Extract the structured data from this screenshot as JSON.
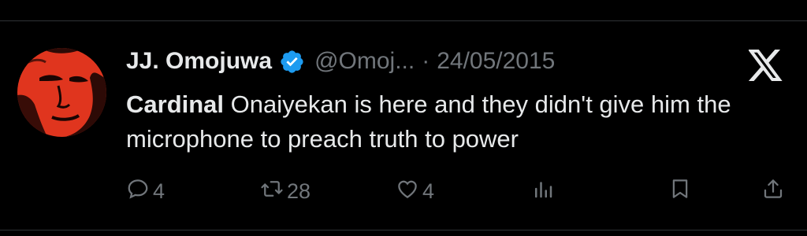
{
  "tweet": {
    "author_name": "JJ. Omojuwa",
    "handle": "@Omoj...",
    "separator": "·",
    "date": "24/05/2015",
    "text_first": "Cardinal",
    "text_rest": " Onaiyekan is here and they didn't give him the microphone to preach truth to power",
    "verified": true
  },
  "actions": {
    "reply_count": "4",
    "retweet_count": "28",
    "like_count": "4"
  },
  "icons": {
    "verified": "verified-badge-icon",
    "platform": "x-logo-icon",
    "reply": "reply-icon",
    "retweet": "retweet-icon",
    "like": "heart-icon",
    "views": "views-icon",
    "bookmark": "bookmark-icon",
    "share": "share-icon"
  },
  "colors": {
    "background": "#000000",
    "text": "#e7e9ea",
    "muted": "#71767b",
    "verified": "#1d9bf0",
    "avatar": "#e0351e"
  }
}
